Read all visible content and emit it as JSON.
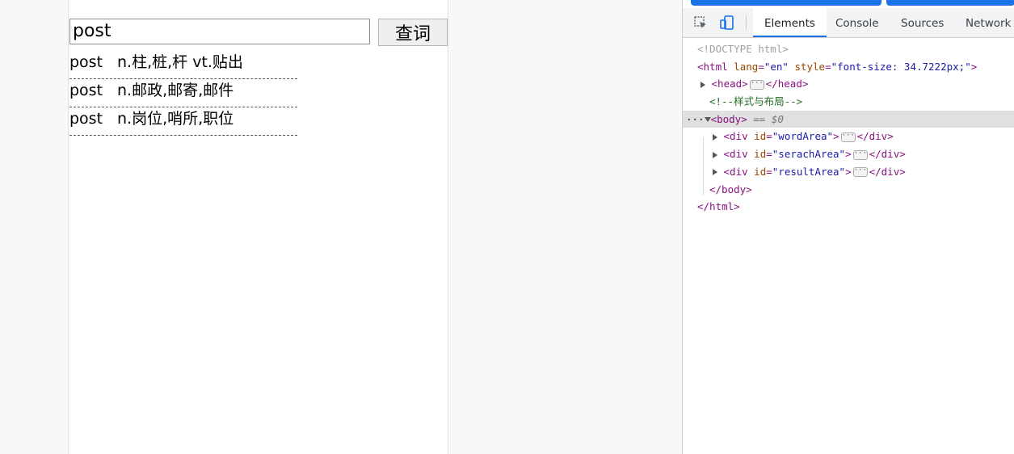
{
  "search": {
    "input_value": "post",
    "button_label": "查词"
  },
  "results": [
    {
      "word": "post",
      "definition": "n.柱,桩,杆 vt.贴出"
    },
    {
      "word": "post",
      "definition": "n.邮政,邮寄,邮件"
    },
    {
      "word": "post",
      "definition": "n.岗位,哨所,职位"
    }
  ],
  "devtools": {
    "tabs": [
      "Elements",
      "Console",
      "Sources",
      "Network"
    ],
    "active_tab": "Elements",
    "dom": {
      "doctype": "<!DOCTYPE html>",
      "html_open_tag": "<html",
      "html_attr_lang": "lang",
      "html_attr_lang_val": "\"en\"",
      "html_attr_style": "style",
      "html_attr_style_val": "\"font-size: 34.7222px;\"",
      "head_open": "<head>",
      "head_close": "</head>",
      "comment": "<!--样式与布局-->",
      "body_open": "<body>",
      "body_marker": "== $0",
      "divs": [
        {
          "id_val": "\"wordArea\""
        },
        {
          "id_val": "\"serachArea\""
        },
        {
          "id_val": "\"resultArea\""
        }
      ],
      "div_open": "<div",
      "div_attr": "id",
      "div_close": "</div>",
      "body_close": "</body>",
      "html_close": "</html>"
    }
  },
  "colors": {
    "accent": "#1a73e8",
    "tag": "#881280",
    "attr_name": "#994500",
    "attr_value": "#1a1aa6",
    "comment": "#236e25"
  }
}
